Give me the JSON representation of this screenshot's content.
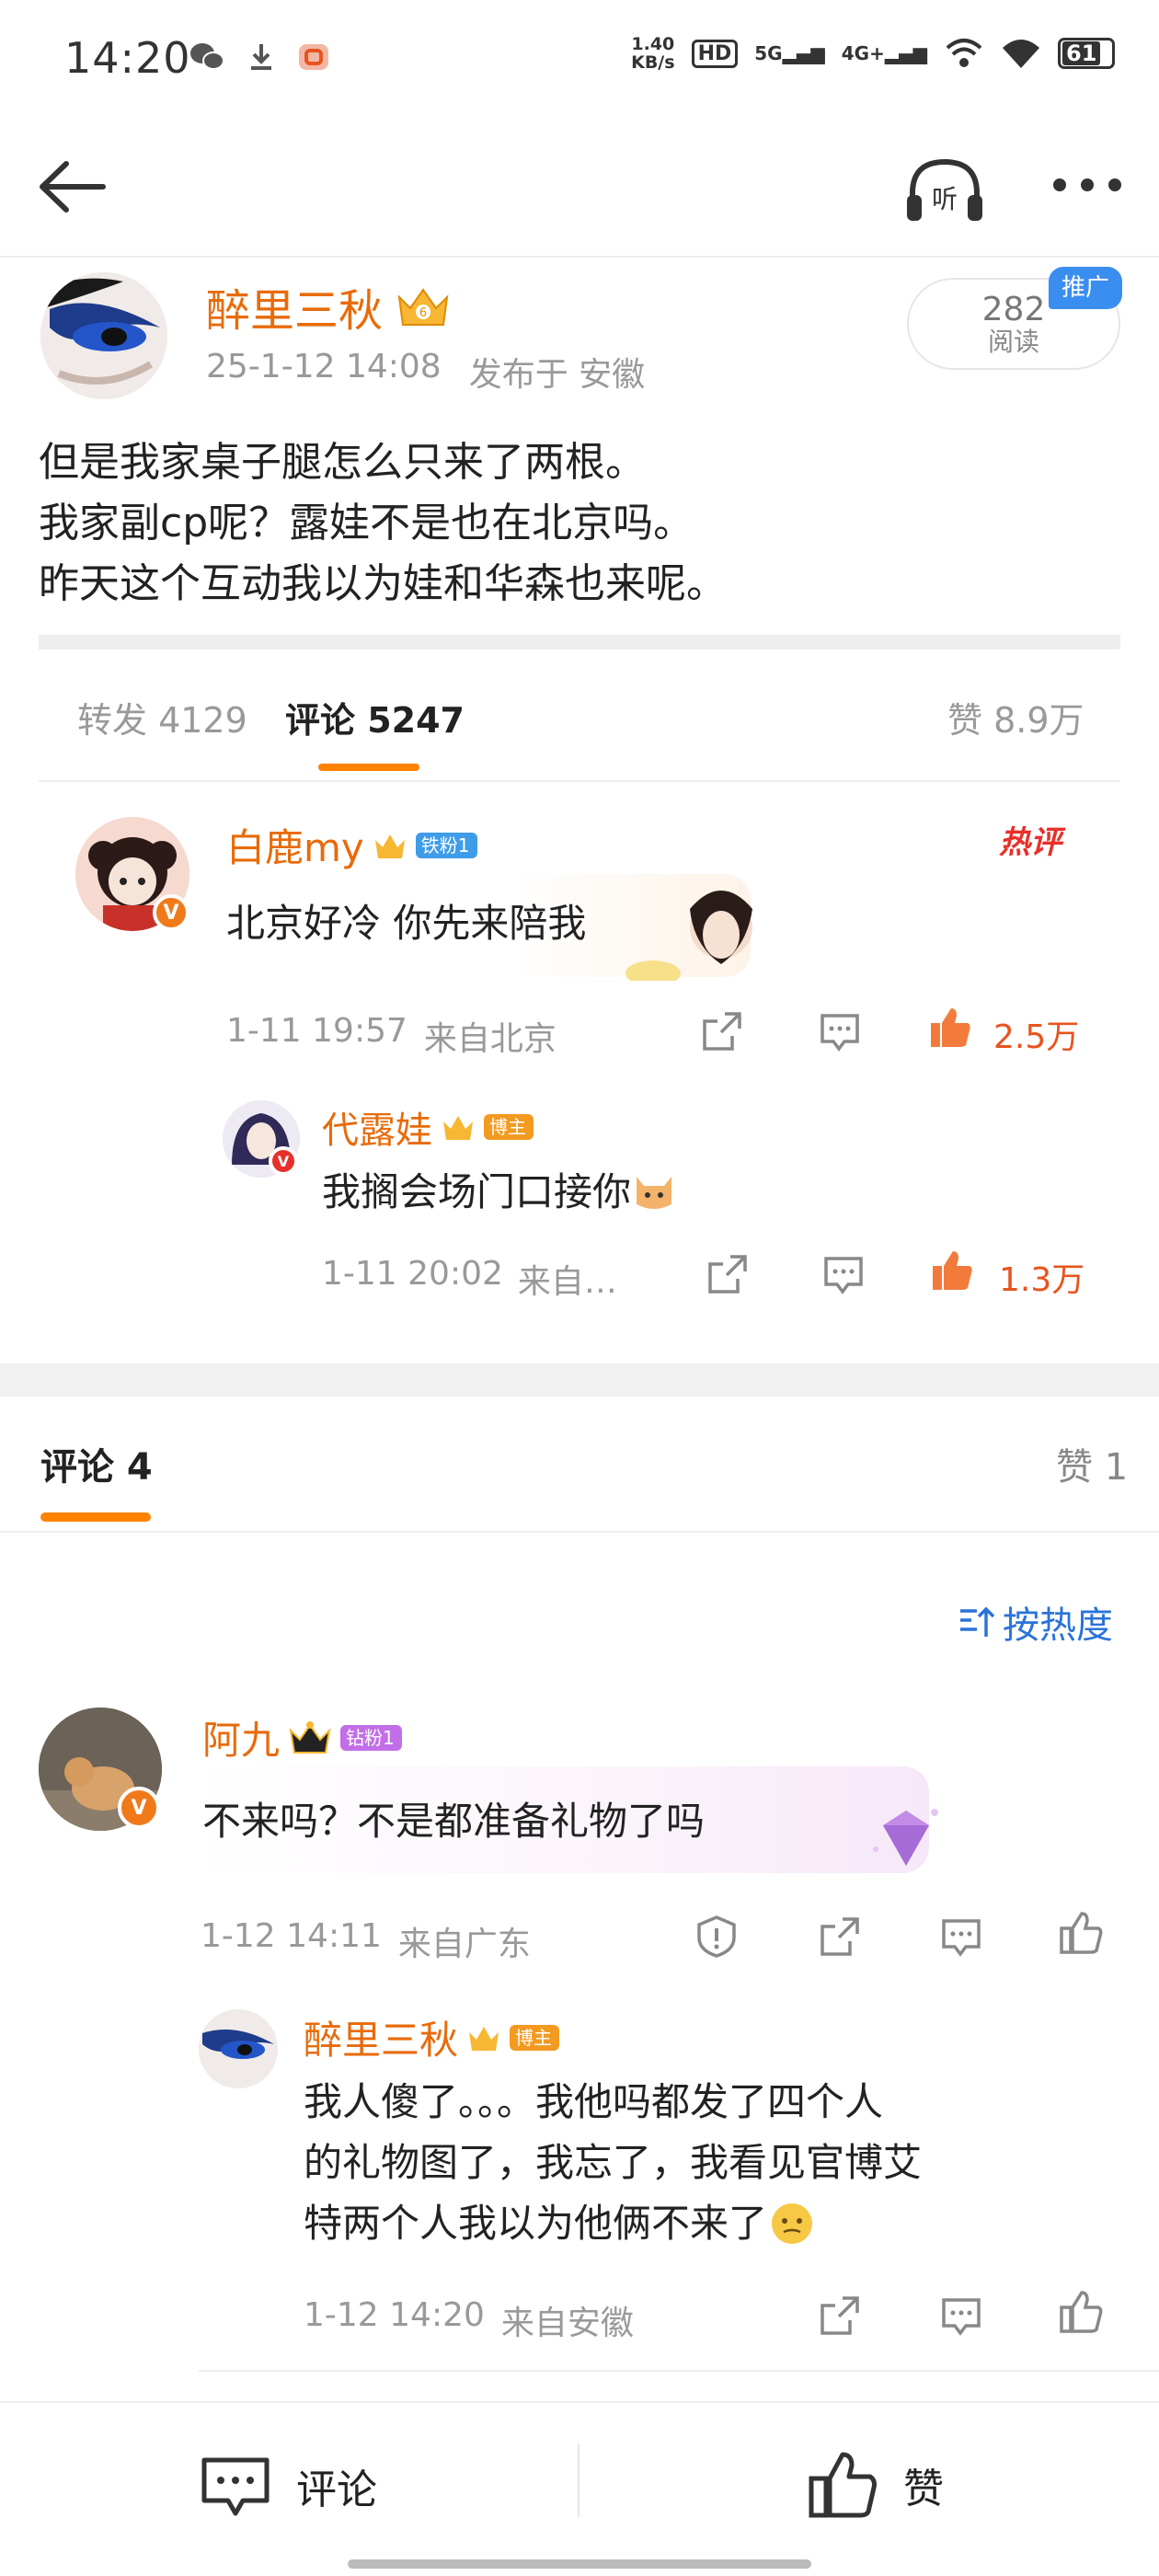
{
  "status_bar": {
    "time": "14:20",
    "net_speed_value": "1.40",
    "net_speed_unit": "KB/s",
    "hd": "HD",
    "sig1": "5G",
    "sig2": "4G+",
    "battery": "61"
  },
  "post": {
    "author": "醉里三秋",
    "time": "25-1-12 14:08",
    "location": "发布于 安徽",
    "read_count": "282",
    "read_label": "阅读",
    "promo": "推广",
    "text": "但是我家桌子腿怎么只来了两根。\n我家副cp呢？露娃不是也在北京吗。\n昨天这个互动我以为娃和华森也来呢。"
  },
  "repost_tabs": {
    "repost": "转发 4129",
    "comments": "评论 5247",
    "likes": "赞 8.9万"
  },
  "hot_comment": {
    "author": "白鹿my",
    "fan_badge": "铁粉1",
    "text": "北京好冷 你先来陪我",
    "hot_label": "热评",
    "time": "1-11 19:57",
    "location": "来自北京",
    "likes": "2.5万",
    "reply": {
      "author": "代露娃",
      "badge": "博主",
      "text": "我搁会场门口接你",
      "time": "1-11 20:02",
      "location": "来自…",
      "likes": "1.3万"
    }
  },
  "comments_section": {
    "tab_label": "评论 4",
    "likes_label": "赞 1",
    "sort_label": "按热度"
  },
  "comment": {
    "author": "阿九",
    "fan_badge": "钻粉1",
    "text": "不来吗？不是都准备礼物了吗",
    "time": "1-12 14:11",
    "location": "来自广东",
    "reply": {
      "author": "醉里三秋",
      "badge": "博主",
      "line1": "我人傻了。。。我他吗都发了四个人",
      "line2": "的礼物图了，我忘了，我看见官博艾",
      "line3": "特两个人我以为他俩不来了",
      "time": "1-12 14:20",
      "location": "来自安徽"
    }
  },
  "bottom_bar": {
    "comment_label": "评论",
    "like_label": "赞"
  },
  "colors": {
    "orange": "#e86b0a",
    "like_red": "#e8541e",
    "blue": "#2a73d9",
    "accent_underline": "#ff8200"
  }
}
